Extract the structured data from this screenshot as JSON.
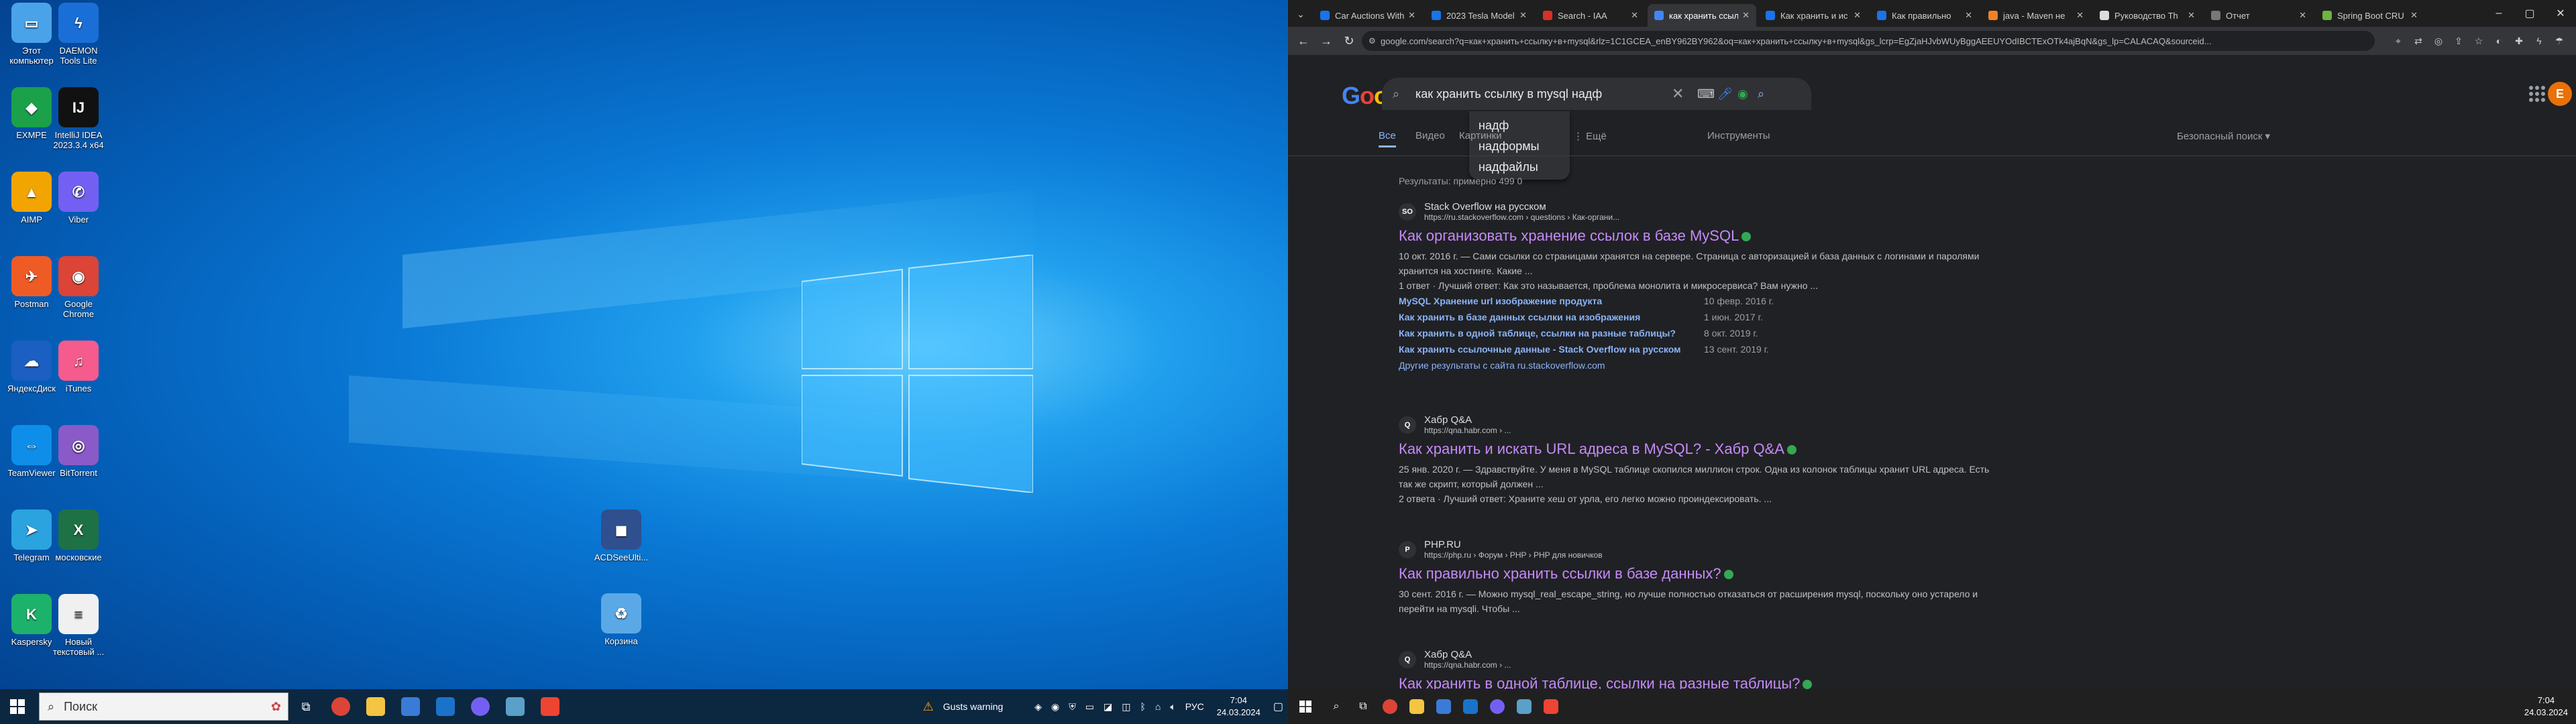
{
  "desktop": {
    "icons": [
      {
        "label": "Этот компьютер",
        "icon": "computer-icon",
        "color": "#4aa3e8",
        "glyph": "▭"
      },
      {
        "label": "DAEMON Tools Lite",
        "icon": "daemon-icon",
        "color": "#1a6fd6",
        "glyph": "ϟ"
      },
      {
        "label": "EXMPE",
        "icon": "exmpe-icon",
        "color": "#1aa14a",
        "glyph": "◆"
      },
      {
        "label": "IntelliJ IDEA 2023.3.4 x64",
        "icon": "intellij-icon",
        "color": "#111111",
        "glyph": "IJ"
      },
      {
        "label": "AIMP",
        "icon": "aimp-icon",
        "color": "#f2a500",
        "glyph": "▲"
      },
      {
        "label": "Viber",
        "icon": "viber-icon",
        "color": "#7360f2",
        "glyph": "✆"
      },
      {
        "label": "Postman",
        "icon": "postman-icon",
        "color": "#ef5b25",
        "glyph": "✈"
      },
      {
        "label": "Google Chrome",
        "icon": "chrome-icon",
        "color": "#db4437",
        "glyph": "◉"
      },
      {
        "label": "ЯндексДиск",
        "icon": "yandex-disk-icon",
        "color": "#1a5fc1",
        "glyph": "☁"
      },
      {
        "label": "iTunes",
        "icon": "itunes-icon",
        "color": "#f55b8c",
        "glyph": "♫"
      },
      {
        "label": "TeamViewer",
        "icon": "teamviewer-icon",
        "color": "#0e8ee9",
        "glyph": "⇔"
      },
      {
        "label": "BitTorrent",
        "icon": "bittorrent-icon",
        "color": "#8a5ac8",
        "glyph": "◎"
      },
      {
        "label": "Telegram",
        "icon": "telegram-icon",
        "color": "#2aa3df",
        "glyph": "➤"
      },
      {
        "label": "московские",
        "icon": "excel-icon",
        "color": "#1e7145",
        "glyph": "X"
      },
      {
        "label": "Kaspersky",
        "icon": "kaspersky-icon",
        "color": "#1db26b",
        "glyph": "K"
      },
      {
        "label": "Новый текстовый ...",
        "icon": "text-file-icon",
        "color": "#f0f0f0",
        "glyph": "≡"
      }
    ],
    "right_icons": [
      {
        "label": "ACDSeeUlti...",
        "icon": "acdsee-icon",
        "color": "#2f4f8f",
        "glyph": "◼"
      },
      {
        "label": "Корзина",
        "icon": "recycle-bin-icon",
        "color": "#5aa9e6",
        "glyph": "♻"
      }
    ]
  },
  "taskbar_left": {
    "search_placeholder": "Поиск",
    "weather": "Gusts warning",
    "lang": "РУС",
    "time": "7:04",
    "date": "24.03.2024"
  },
  "browser": {
    "tabs": [
      {
        "title": "Car Auctions With",
        "color": "#1a73e8"
      },
      {
        "title": "2023 Tesla Model",
        "color": "#1a73e8"
      },
      {
        "title": "Search - IAA",
        "color": "#d93025"
      },
      {
        "title": "как хранить ссыл",
        "color": "#4285f4",
        "active": true
      },
      {
        "title": "Как хранить и ис",
        "color": "#1a73e8"
      },
      {
        "title": "Как правильно",
        "color": "#1a73e8"
      },
      {
        "title": "java - Maven не",
        "color": "#f48024"
      },
      {
        "title": "Руководство Th",
        "color": "#dddddd"
      },
      {
        "title": "Отчет",
        "color": "#777777"
      },
      {
        "title": "Spring Boot CRU",
        "color": "#6db33f"
      }
    ],
    "url": "google.com/search?q=как+хранить+ссылку+в+mysql&rlz=1C1GCEA_enBY962BY962&oq=как+хранить+ссылку+в+mysql&gs_lcrp=EgZjaHJvbWUyBggAEEUYOdIBCTExOTk4ajBqN&gs_lp=CALACAQ&sourceid..."
  },
  "google": {
    "query": "как хранить ссылку в mysql надф",
    "suggestions": [
      "надф",
      "надформы",
      "надфайлы"
    ],
    "tabs": [
      "Все",
      "Видео",
      "Картинки",
      "⋮ Ещё",
      "Инструменты"
    ],
    "safesearch": "Безопасный поиск ▾",
    "stats": "Результаты: примерно 499 0",
    "avatar": "E",
    "results": [
      {
        "site": "Stack Overflow на русском",
        "cite": "https://ru.stackoverflow.com › questions › Как-органи...",
        "title": "Как организовать хранение ссылок в базе MySQL",
        "snippet": "10 окт. 2016 г. — Сами ссылки со страницами хранятся на сервере. Страница с авторизацией и база данных с логинами и паролями хранится на хостинге. Какие ...",
        "answer": "1 ответ · Лучший ответ: Как это называется, проблема монолита и микросервиса? Вам нужно ...",
        "subs": [
          {
            "text": "MySQL Хранение url изображение продукта",
            "date": "10 февр. 2016 г."
          },
          {
            "text": "Как хранить в базе данных ссылки на изображения",
            "date": "1 июн. 2017 г."
          },
          {
            "text": "Как хранить в одной таблице, ссылки на разные таблицы?",
            "date": "8 окт. 2019 г."
          },
          {
            "text": "Как хранить ссылочные данные - Stack Overflow на русском",
            "date": "13 сент. 2019 г."
          }
        ],
        "more": "Другие результаты с сайта ru.stackoverflow.com"
      },
      {
        "site": "Хабр Q&A",
        "cite": "https://qna.habr.com › ...",
        "title": "Как хранить и искать URL адреса в MySQL? - Хабр Q&A",
        "snippet": "25 янв. 2020 г. — Здравствуйте. У меня в MySQL таблице скопился миллион строк. Одна из колонок таблицы хранит URL адреса. Есть так же скрипт, который должен ...",
        "answer": "2 ответа · Лучший ответ: Храните хеш от урла, его легко можно проиндексировать. ..."
      },
      {
        "site": "PHP.RU",
        "cite": "https://php.ru › Форум › PHP › PHP для новичков",
        "title": "Как правильно хранить ссылки в базе данных?",
        "snippet": "30 сент. 2016 г. — Можно mysql_real_escape_string, но лучше полностью отказаться от расширения mysql, поскольку оно устарело и перейти на mysqli. Чтобы ..."
      },
      {
        "site": "Хабр Q&A",
        "cite": "https://qna.habr.com › ...",
        "title": "Как хранить в одной таблице, ссылки на разные таблицы?"
      }
    ]
  },
  "taskbar_right": {
    "time": "7:04",
    "date": "24.03.2024"
  }
}
